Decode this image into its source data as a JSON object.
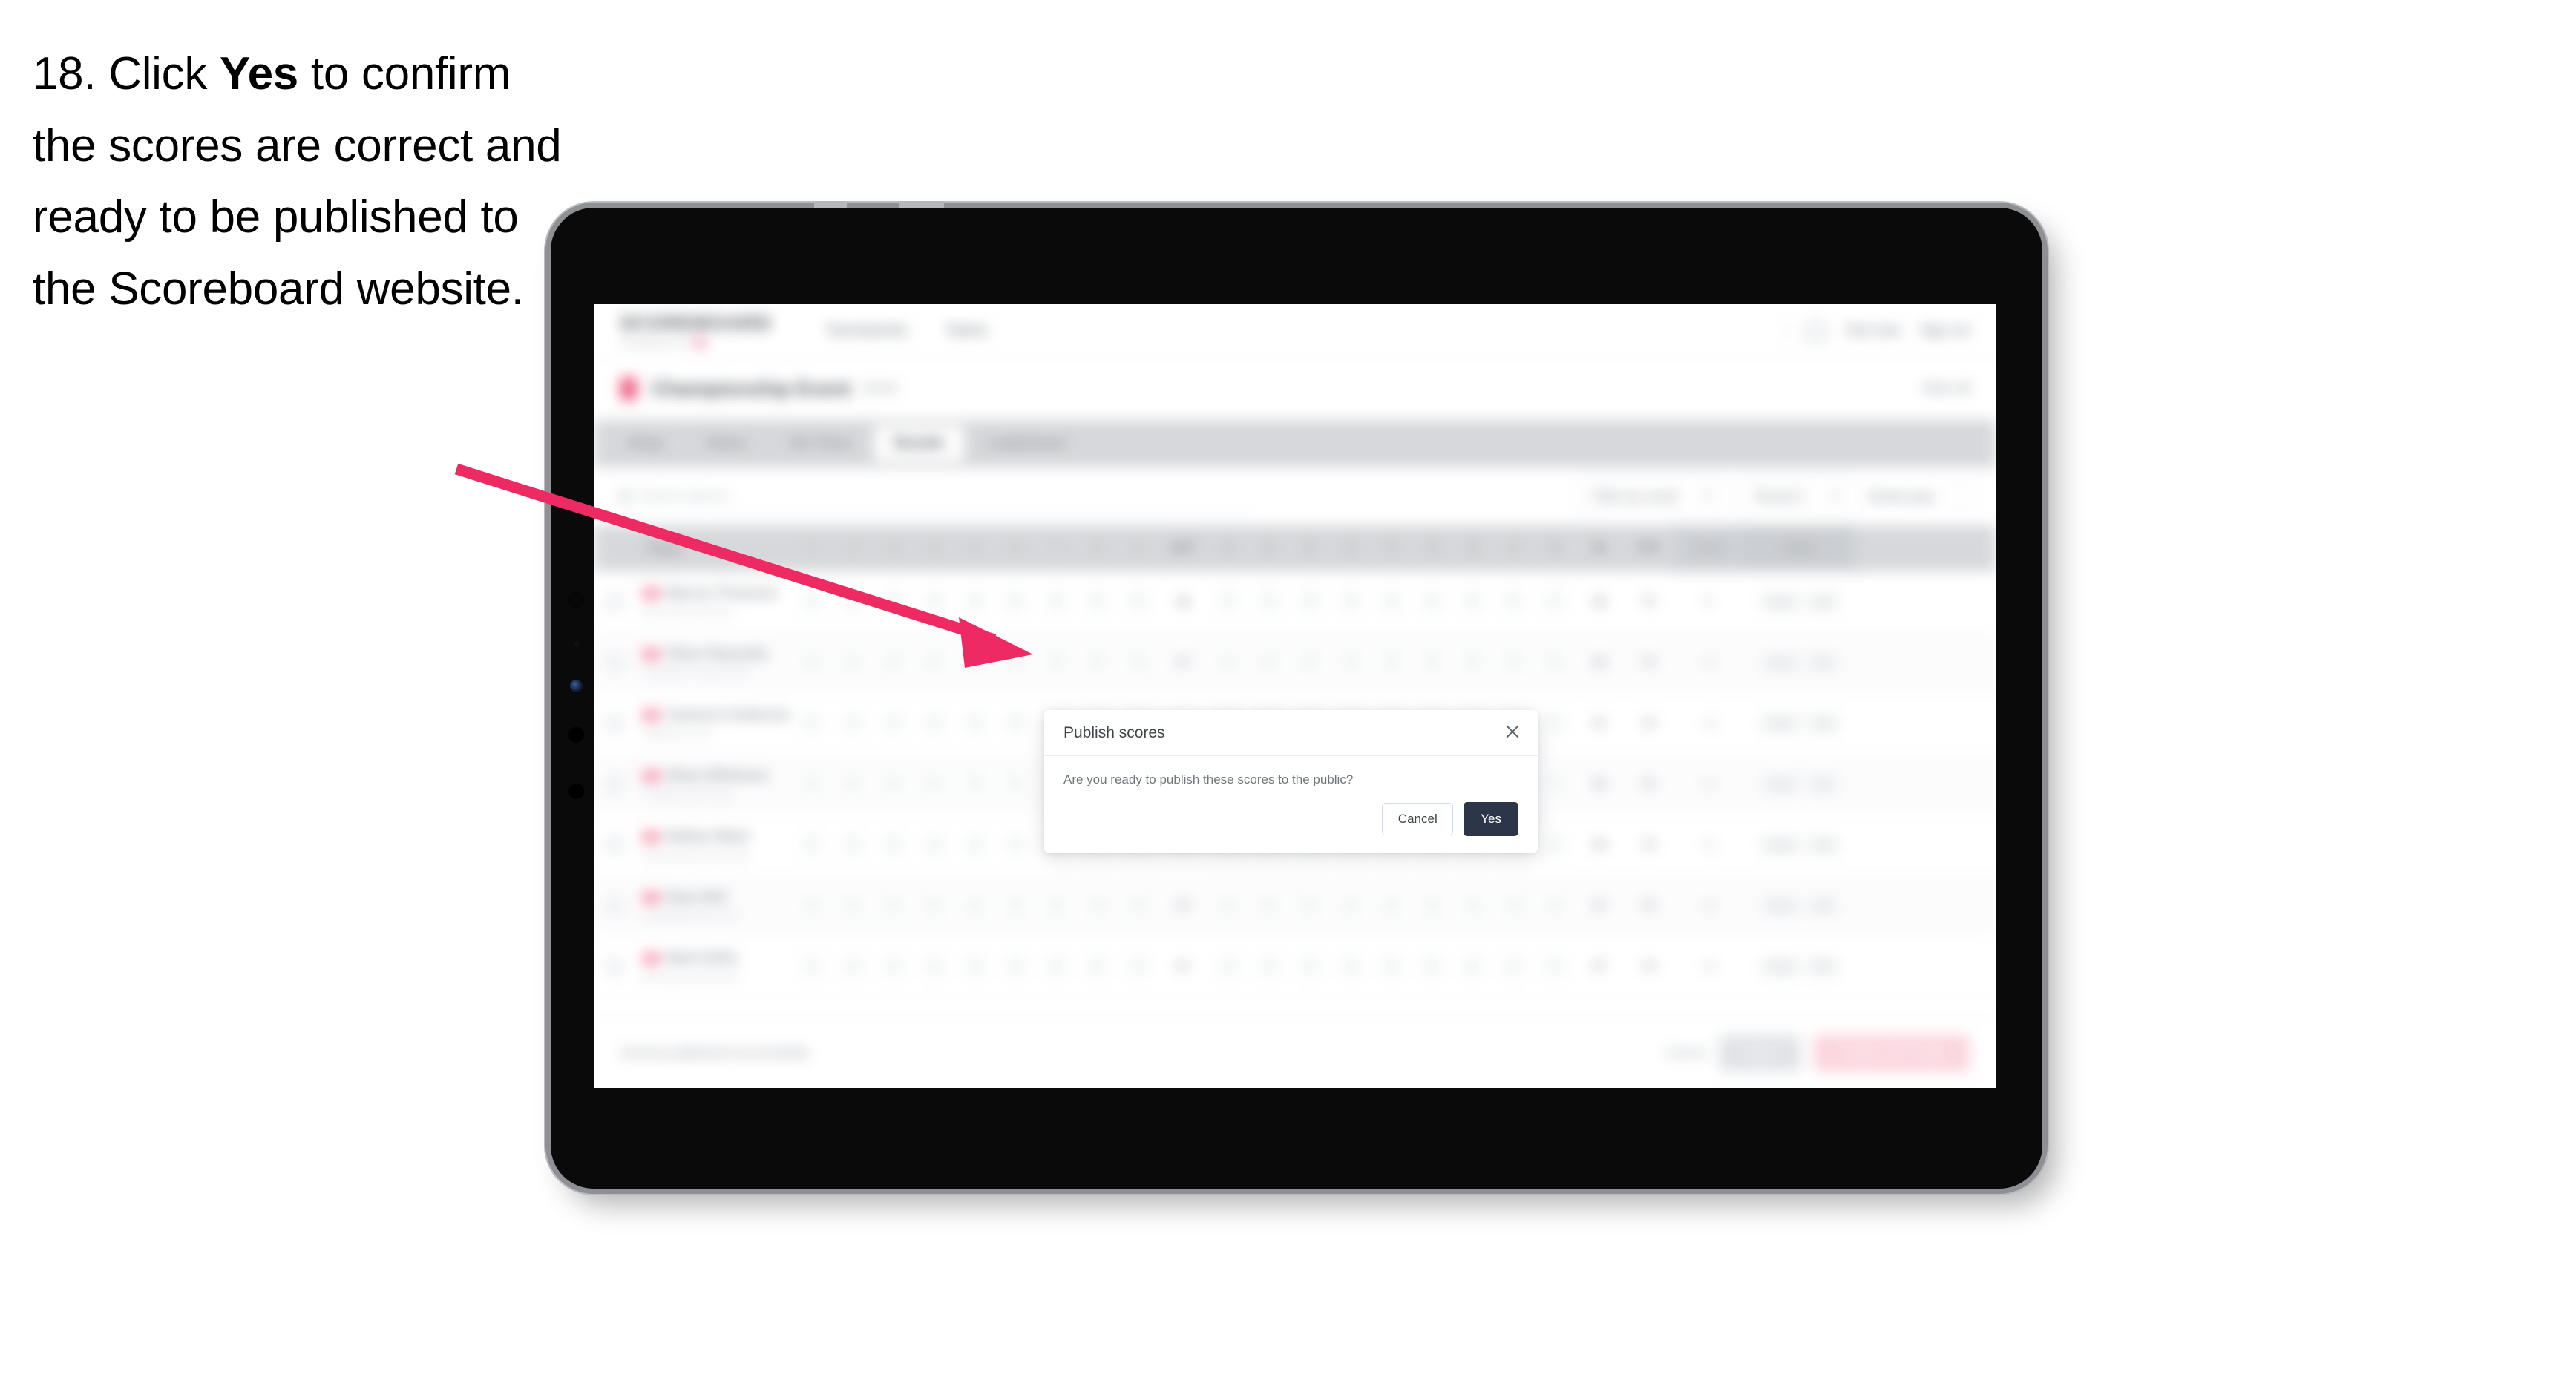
{
  "instruction": {
    "step_number": "18.",
    "text_before": " Click ",
    "emphasis": "Yes",
    "text_after": " to confirm the scores are correct and ready to be published to the Scoreboard website."
  },
  "colors": {
    "arrow": "#ee2a62",
    "primary_button": "#2c3648",
    "brand_pink": "#ef4d74",
    "device_bezel": "#0a0a0a",
    "device_frame": "#b9bbbe",
    "tab_bar": "#d4d6d9"
  },
  "app": {
    "header": {
      "brand_word": "SCOREBOARD",
      "brand_sub": "POWERED BY",
      "nav": [
        "Tournaments",
        "Teams"
      ],
      "notifications_icon": "bell-icon",
      "user_name": "Test User",
      "sign_out": "Sign out"
    },
    "title_strip": {
      "flag_icon": "flag-icon",
      "title": "Championship Event",
      "subtitle": "2024",
      "right_label": "View all"
    },
    "tabs": [
      {
        "label": "Setup",
        "active": false
      },
      {
        "label": "Teams",
        "active": false
      },
      {
        "label": "Tee Times",
        "active": false
      },
      {
        "label": "Results",
        "active": true
      },
      {
        "label": "Leaderboard",
        "active": false
      }
    ],
    "filter_bar": {
      "search_placeholder": "Search players",
      "search_icon": "search-icon",
      "selects": [
        {
          "label": "Filter by round"
        },
        {
          "label": "Round 1"
        }
      ],
      "extra_label": "Stroke play",
      "settings_icon": "settings-icon"
    },
    "table": {
      "columns": {
        "check": "",
        "player": "Player",
        "holes": [
          "1",
          "2",
          "3",
          "4",
          "5",
          "6",
          "7",
          "8",
          "9"
        ],
        "out": "OUT",
        "holes_back": [
          "10",
          "11",
          "12",
          "13",
          "14",
          "15",
          "16",
          "17",
          "18"
        ],
        "in": "IN",
        "total": "TOT",
        "score": "Score",
        "status": "Status"
      },
      "rows": [
        {
          "name": "Marcus Thomson",
          "club": "Riverside Golf Club",
          "front": [
            "4",
            "5",
            "3",
            "4",
            "4",
            "5",
            "3",
            "4",
            "4"
          ],
          "out": "36",
          "back": [
            "4",
            "4",
            "5",
            "3",
            "4",
            "4",
            "5",
            "4",
            "3"
          ],
          "in": "36",
          "total": "72",
          "score": "E",
          "status": [
            "Final",
            "OK"
          ]
        },
        {
          "name": "Oliver Reynolds",
          "club": "Lakeside Country Club",
          "front": [
            "4",
            "4",
            "4",
            "5",
            "3",
            "4",
            "4",
            "5",
            "4"
          ],
          "out": "37",
          "back": [
            "3",
            "5",
            "4",
            "4",
            "4",
            "3",
            "5",
            "4",
            "4"
          ],
          "in": "36",
          "total": "73",
          "score": "+1",
          "status": [
            "Final",
            "OK"
          ]
        },
        {
          "name": "Cameron Anderson",
          "club": "Highland Links",
          "front": [
            "5",
            "4",
            "3",
            "4",
            "4",
            "4",
            "5",
            "4",
            "4"
          ],
          "out": "37",
          "back": [
            "4",
            "4",
            "4",
            "5",
            "3",
            "4",
            "4",
            "4",
            "5"
          ],
          "in": "37",
          "total": "74",
          "score": "+2",
          "status": [
            "Final",
            "OK"
          ]
        },
        {
          "name": "Ethan Whitmore",
          "club": "Pinehurst Golf Club",
          "front": [
            "4",
            "5",
            "4",
            "4",
            "3",
            "5",
            "4",
            "4",
            "4"
          ],
          "out": "37",
          "back": [
            "4",
            "3",
            "5",
            "4",
            "4",
            "5",
            "4",
            "3",
            "4"
          ],
          "in": "36",
          "total": "73",
          "score": "+1",
          "status": [
            "Final",
            "OK"
          ]
        },
        {
          "name": "Nathan Ward",
          "club": "Ravenswood Golf Club",
          "front": [
            "4",
            "4",
            "5",
            "4",
            "4",
            "3",
            "4",
            "5",
            "4"
          ],
          "out": "37",
          "back": [
            "5",
            "4",
            "4",
            "3",
            "4",
            "4",
            "4",
            "5",
            "3"
          ],
          "in": "36",
          "total": "73",
          "score": "+1",
          "status": [
            "Final",
            "OK"
          ]
        },
        {
          "name": "Ryan Bell",
          "club": "Castlefield Golf Club",
          "front": [
            "3",
            "4",
            "4",
            "5",
            "4",
            "4",
            "4",
            "4",
            "5"
          ],
          "out": "37",
          "back": [
            "4",
            "5",
            "3",
            "4",
            "5",
            "4",
            "4",
            "4",
            "4"
          ],
          "in": "37",
          "total": "74",
          "score": "+2",
          "status": [
            "Final",
            "OK"
          ]
        },
        {
          "name": "Mark Hollis",
          "club": "Birchwood Golf Club",
          "front": [
            "4",
            "4",
            "4",
            "4",
            "5",
            "4",
            "3",
            "5",
            "4"
          ],
          "out": "37",
          "back": [
            "4",
            "4",
            "4",
            "4",
            "3",
            "5",
            "4",
            "4",
            "5"
          ],
          "in": "37",
          "total": "74",
          "score": "+2",
          "status": [
            "Final",
            "OK"
          ]
        }
      ]
    },
    "footer": {
      "note": "Scores published successfully",
      "cancel_text": "Cancel",
      "grey_button": "Save",
      "pink_button": "Publish and notify"
    }
  },
  "modal": {
    "title": "Publish scores",
    "close_icon": "close-icon",
    "message": "Are you ready to publish these scores to the public?",
    "cancel_label": "Cancel",
    "confirm_label": "Yes"
  }
}
